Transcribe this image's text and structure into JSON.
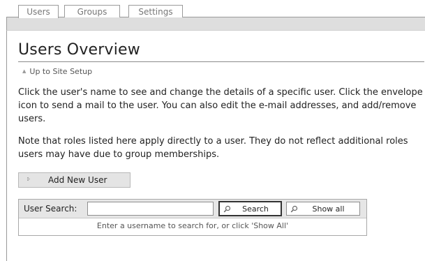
{
  "tabs": [
    {
      "label": "Users",
      "active": true
    },
    {
      "label": "Groups",
      "active": false
    },
    {
      "label": "Settings",
      "active": false
    }
  ],
  "page": {
    "title": "Users Overview",
    "back_link": "Up to Site Setup",
    "intro": "Click the user's name to see and change the details of a specific user. Click the envelope icon to send a mail to the user. You can also edit the e-mail addresses, and add/remove users.",
    "note": "Note that roles listed here apply directly to a user. They do not reflect additional roles users may have due to group memberships."
  },
  "actions": {
    "add_user": "Add New User"
  },
  "search": {
    "label": "User Search:",
    "value": "",
    "search_button": "Search",
    "show_all_button": "Show all",
    "hint": "Enter a username to search for, or click 'Show All'"
  },
  "icons": {
    "back": "up-triangle-icon",
    "add": "dots-icon",
    "search": "magnifier-icon"
  }
}
